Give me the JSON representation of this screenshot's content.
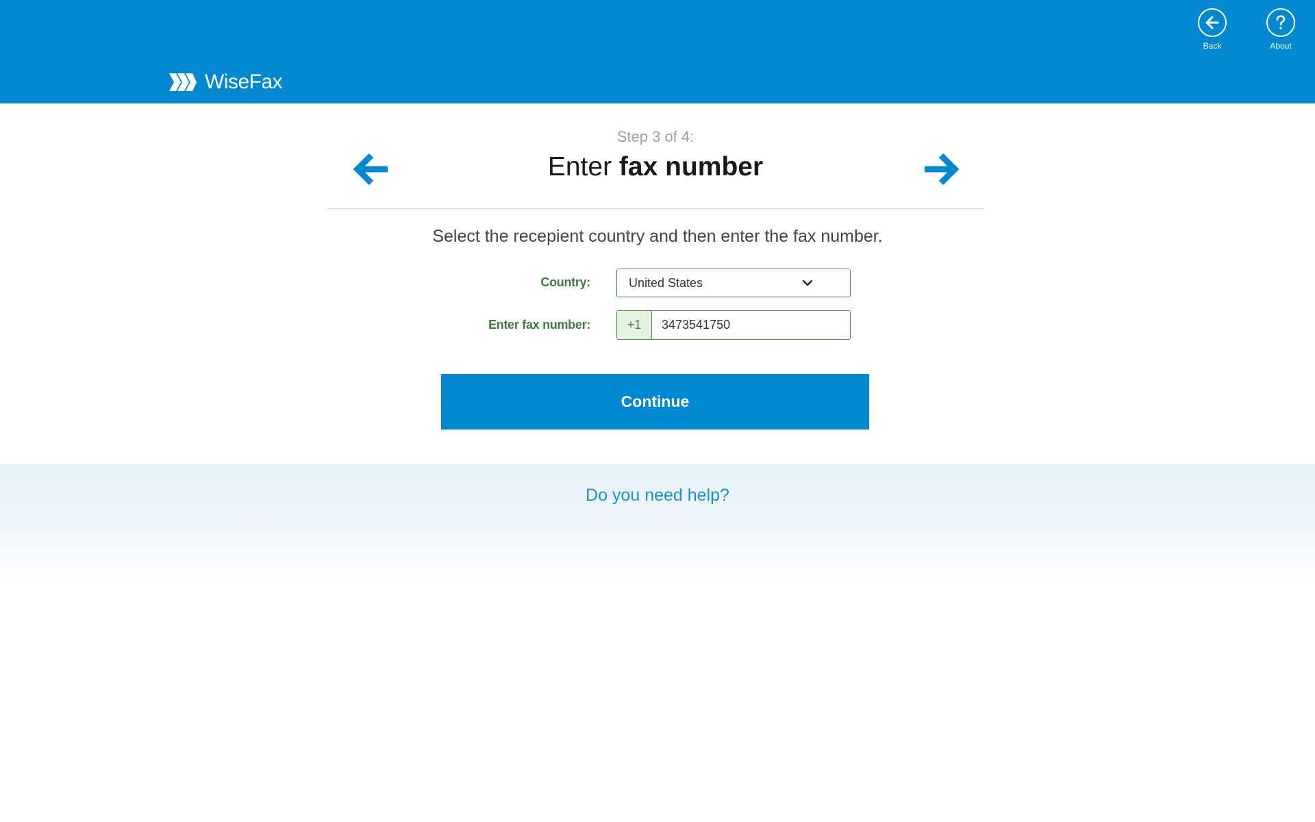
{
  "header": {
    "brand": "WiseFax",
    "accent_color": "#0288d1",
    "appbar": [
      {
        "label": "Back",
        "icon": "arrow-left-circle-icon"
      },
      {
        "label": "About",
        "icon": "question-circle-icon"
      }
    ]
  },
  "step": {
    "progress": "Step 3 of 4:",
    "title_prefix": "Enter",
    "title_bold": "fax number",
    "prev_icon": "arrow-left-icon",
    "next_icon": "arrow-right-icon"
  },
  "form": {
    "instruction": "Select the recepient country and then enter the fax number.",
    "country_label": "Country:",
    "country_value": "United States",
    "fax_label": "Enter fax number:",
    "fax_prefix": "+1",
    "fax_value": "3473541750",
    "label_color": "#3d7a3d"
  },
  "actions": {
    "continue_label": "Continue"
  },
  "footer": {
    "help_link": "Do you need help?"
  }
}
